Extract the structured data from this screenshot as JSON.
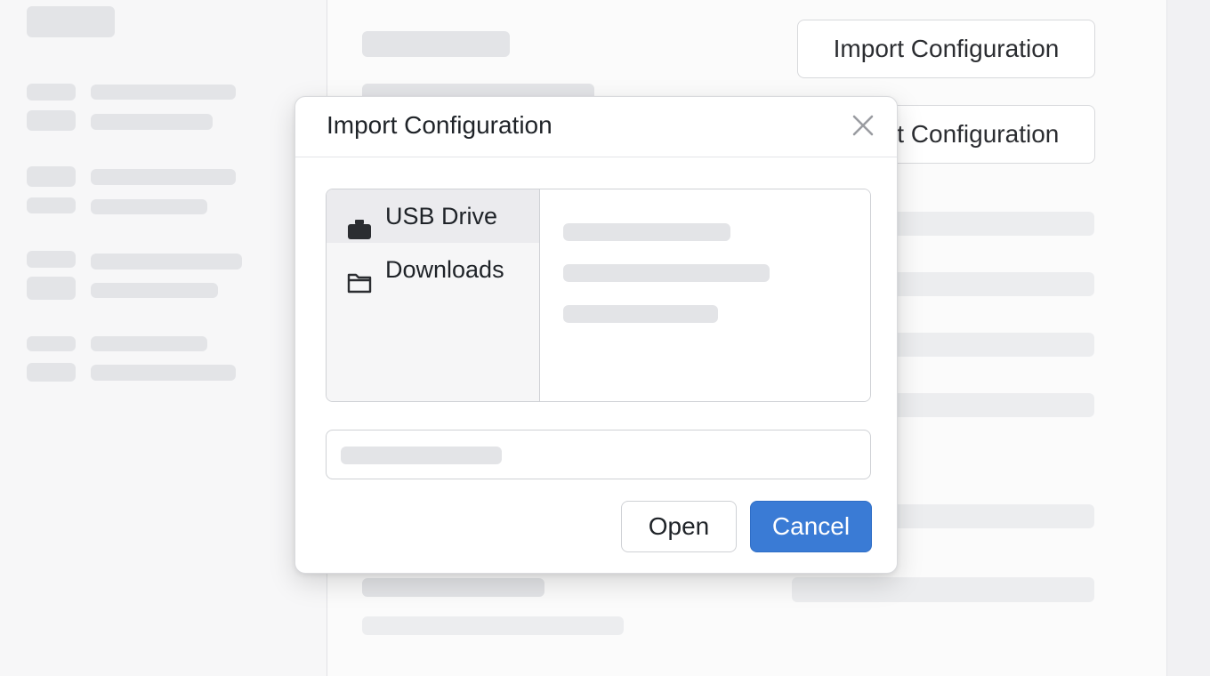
{
  "background": {
    "import_button_label": "Import Configuration",
    "import_button_label_secondary": "Import Configuration"
  },
  "dialog": {
    "title": "Import Configuration",
    "close_icon": "close-icon",
    "places": [
      {
        "label": "USB Drive",
        "icon": "usb-drive-icon",
        "selected": true
      },
      {
        "label": "Downloads",
        "icon": "folder-icon",
        "selected": false
      }
    ],
    "filename_value": "",
    "open_label": "Open",
    "cancel_label": "Cancel"
  },
  "colors": {
    "primary": "#3a7bd5",
    "skeleton": "#e3e4e7"
  }
}
